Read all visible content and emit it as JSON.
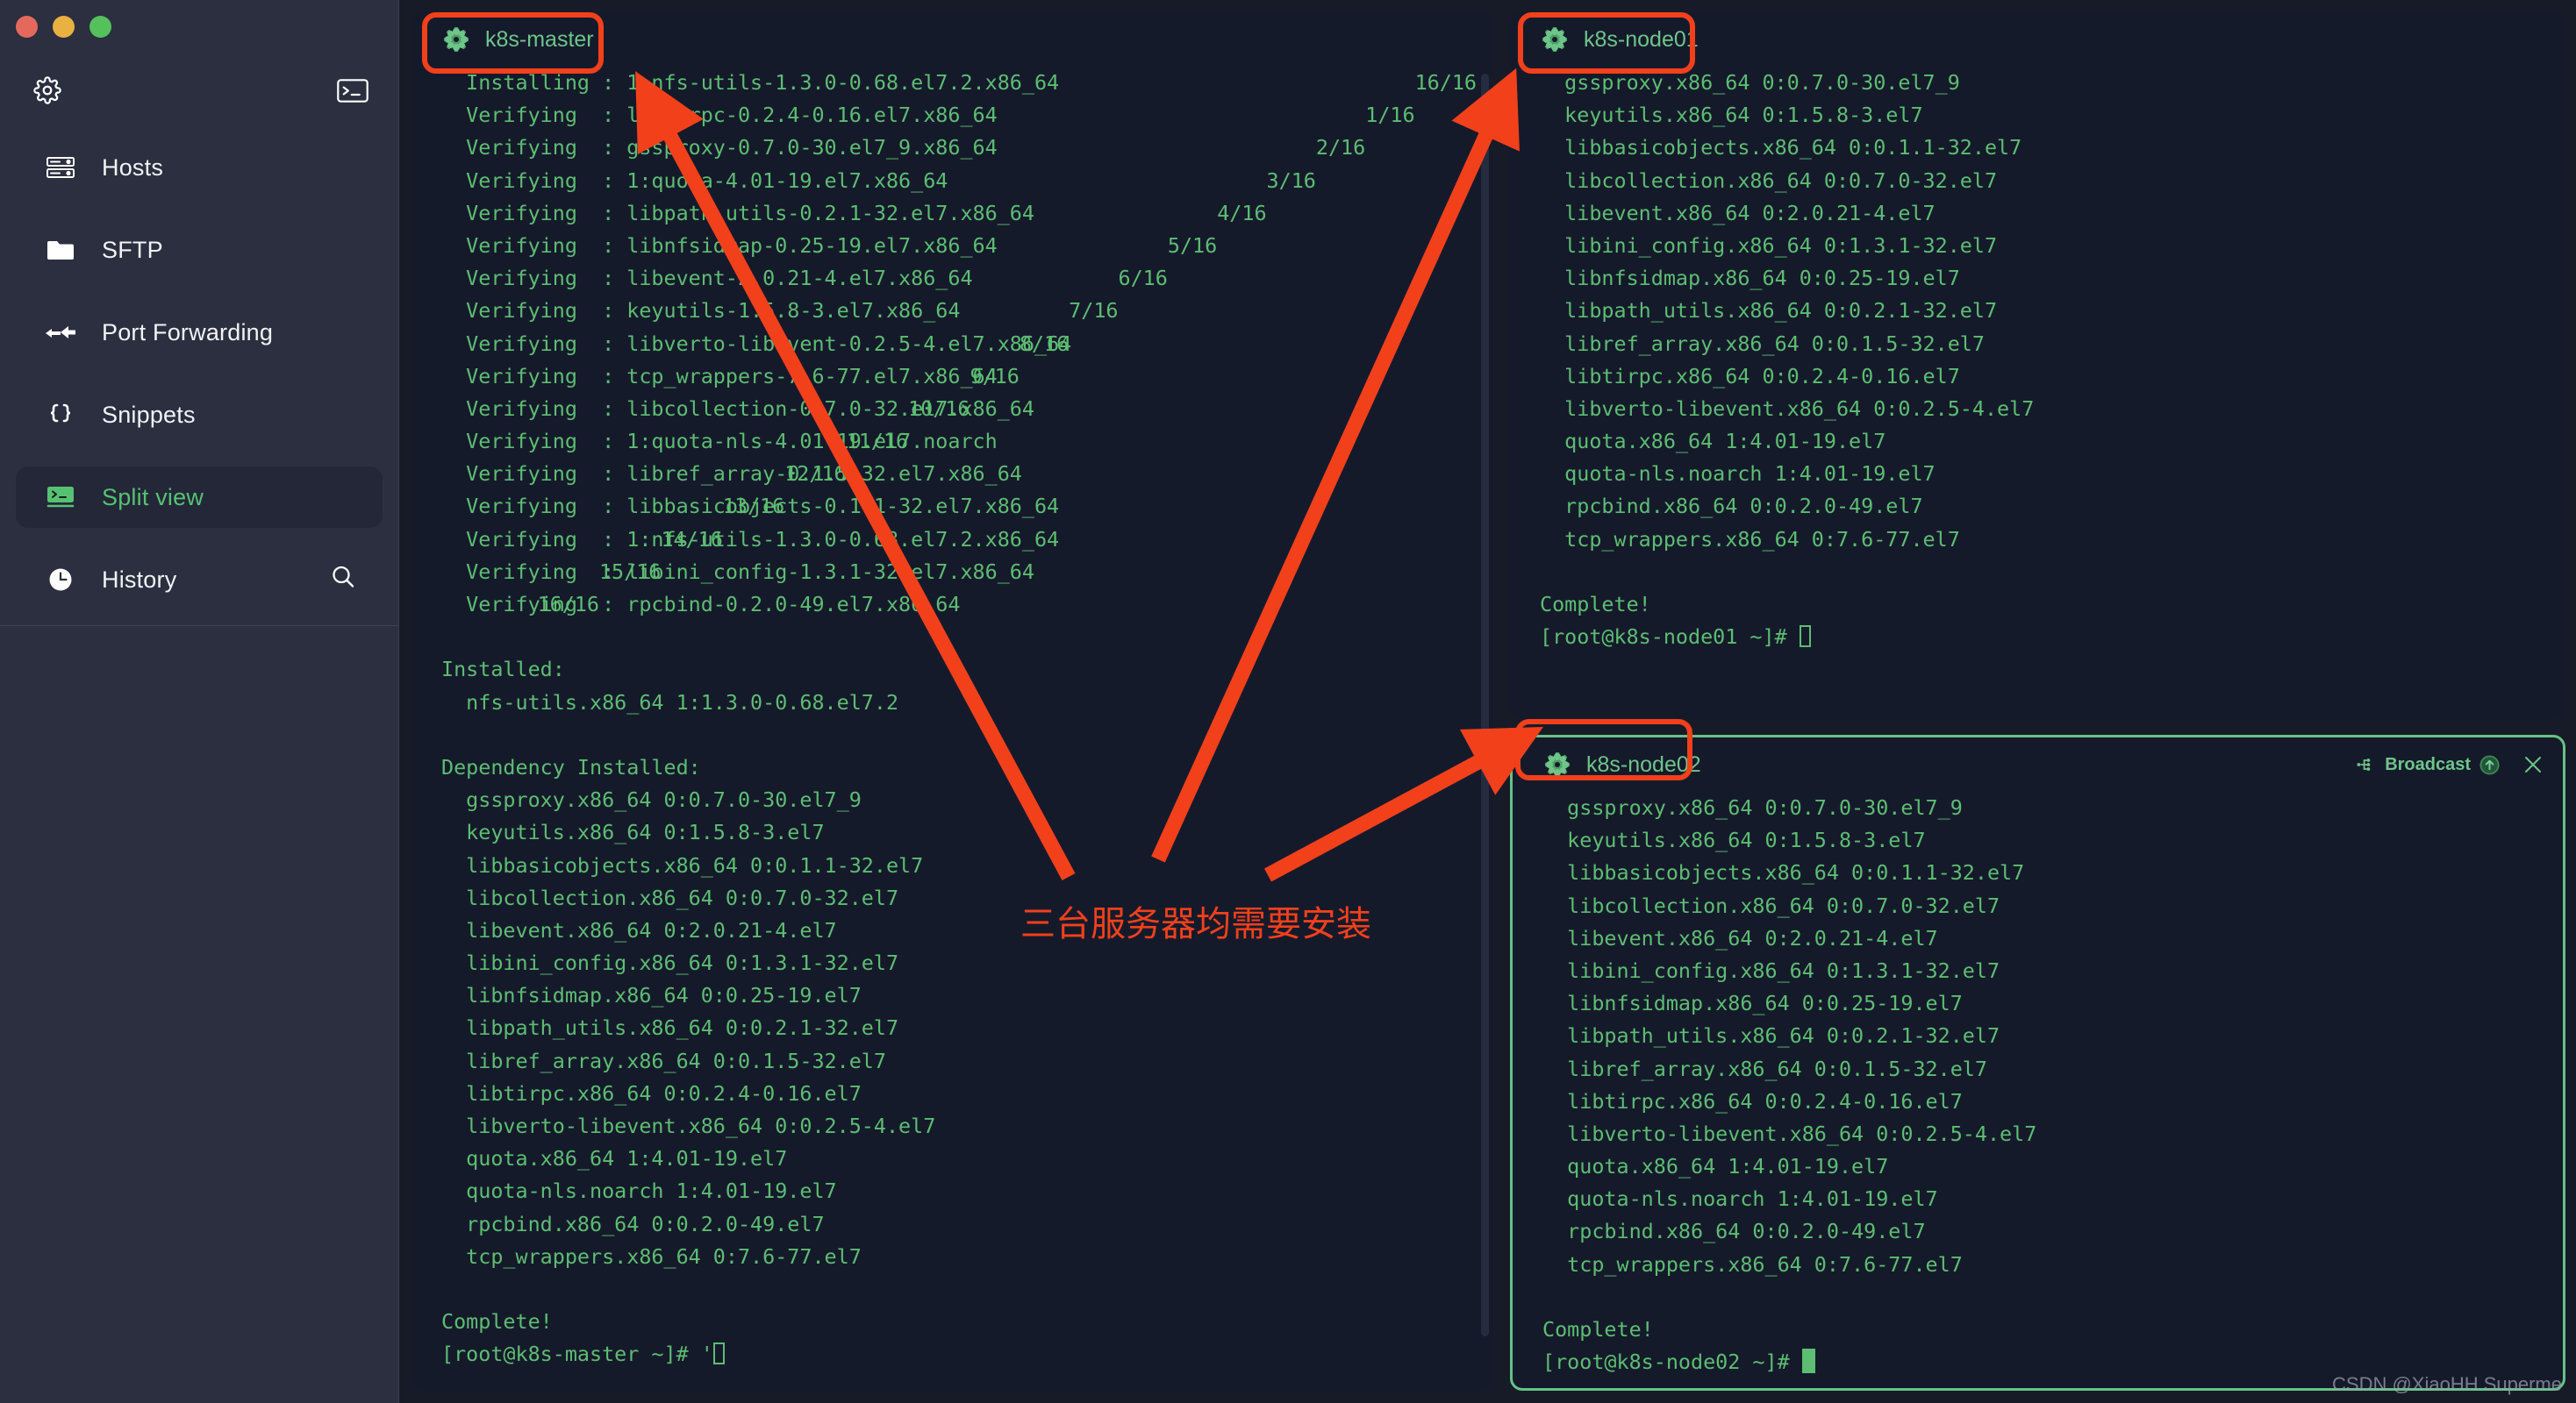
{
  "window": {
    "traffic_lights": [
      "close",
      "minimize",
      "maximize"
    ]
  },
  "sidebar": {
    "top_icons": [
      {
        "name": "gear-icon",
        "label": "Settings"
      },
      {
        "name": "terminal-icon",
        "label": "New terminal"
      }
    ],
    "items": [
      {
        "label": "Hosts",
        "icon": "server-rack-icon",
        "active": false
      },
      {
        "label": "SFTP",
        "icon": "folder-icon",
        "active": false
      },
      {
        "label": "Port Forwarding",
        "icon": "arrow-forward-icon",
        "active": false
      },
      {
        "label": "Snippets",
        "icon": "braces-icon",
        "active": false
      },
      {
        "label": "Split view",
        "icon": "split-view-icon",
        "active": true
      },
      {
        "label": "History",
        "icon": "clock-icon",
        "active": false,
        "trailing_icon": "search-icon"
      }
    ]
  },
  "colors": {
    "accent_green": "#56c271",
    "terminal_green": "#5dbd72",
    "annotation_red": "#f2401b",
    "focus_border": "#67c286",
    "sidebar_bg": "#2b2f3f",
    "terminal_bg": "#151a2b"
  },
  "panes": [
    {
      "id": "k8s-master",
      "title": "k8s-master",
      "icon": "k8s-flower-icon",
      "focused": false,
      "has_broadcast": false,
      "lines": [
        {
          "text": "  Installing : 1:nfs-utils-1.3.0-0.68.el7.2.x86_64",
          "count": "16/16"
        },
        {
          "text": "  Verifying  : libtirpc-0.2.4-0.16.el7.x86_64",
          "count": "1/16"
        },
        {
          "text": "  Verifying  : gssproxy-0.7.0-30.el7_9.x86_64",
          "count": "2/16"
        },
        {
          "text": "  Verifying  : 1:quota-4.01-19.el7.x86_64",
          "count": "3/16"
        },
        {
          "text": "  Verifying  : libpath_utils-0.2.1-32.el7.x86_64",
          "count": "4/16"
        },
        {
          "text": "  Verifying  : libnfsidmap-0.25-19.el7.x86_64",
          "count": "5/16"
        },
        {
          "text": "  Verifying  : libevent-2.0.21-4.el7.x86_64",
          "count": "6/16"
        },
        {
          "text": "  Verifying  : keyutils-1.5.8-3.el7.x86_64",
          "count": "7/16"
        },
        {
          "text": "  Verifying  : libverto-libevent-0.2.5-4.el7.x86_64",
          "count": "8/16"
        },
        {
          "text": "  Verifying  : tcp_wrappers-7.6-77.el7.x86_64",
          "count": "9/16"
        },
        {
          "text": "  Verifying  : libcollection-0.7.0-32.el7.x86_64",
          "count": "10/16"
        },
        {
          "text": "  Verifying  : 1:quota-nls-4.01-19.el7.noarch",
          "count": "11/16"
        },
        {
          "text": "  Verifying  : libref_array-0.1.5-32.el7.x86_64",
          "count": "12/16"
        },
        {
          "text": "  Verifying  : libbasicobjects-0.1.1-32.el7.x86_64",
          "count": "13/16"
        },
        {
          "text": "  Verifying  : 1:nfs-utils-1.3.0-0.68.el7.2.x86_64",
          "count": "14/16"
        },
        {
          "text": "  Verifying  : libini_config-1.3.1-32.el7.x86_64",
          "count": "15/16"
        },
        {
          "text": "  Verifying  : rpcbind-0.2.0-49.el7.x86_64",
          "count": "16/16"
        },
        {
          "text": "",
          "count": ""
        },
        {
          "text": "Installed:",
          "count": ""
        },
        {
          "text": "  nfs-utils.x86_64 1:1.3.0-0.68.el7.2",
          "count": ""
        },
        {
          "text": "",
          "count": ""
        },
        {
          "text": "Dependency Installed:",
          "count": ""
        },
        {
          "text": "  gssproxy.x86_64 0:0.7.0-30.el7_9",
          "count": ""
        },
        {
          "text": "  keyutils.x86_64 0:1.5.8-3.el7",
          "count": ""
        },
        {
          "text": "  libbasicobjects.x86_64 0:0.1.1-32.el7",
          "count": ""
        },
        {
          "text": "  libcollection.x86_64 0:0.7.0-32.el7",
          "count": ""
        },
        {
          "text": "  libevent.x86_64 0:2.0.21-4.el7",
          "count": ""
        },
        {
          "text": "  libini_config.x86_64 0:1.3.1-32.el7",
          "count": ""
        },
        {
          "text": "  libnfsidmap.x86_64 0:0.25-19.el7",
          "count": ""
        },
        {
          "text": "  libpath_utils.x86_64 0:0.2.1-32.el7",
          "count": ""
        },
        {
          "text": "  libref_array.x86_64 0:0.1.5-32.el7",
          "count": ""
        },
        {
          "text": "  libtirpc.x86_64 0:0.2.4-0.16.el7",
          "count": ""
        },
        {
          "text": "  libverto-libevent.x86_64 0:0.2.5-4.el7",
          "count": ""
        },
        {
          "text": "  quota.x86_64 1:4.01-19.el7",
          "count": ""
        },
        {
          "text": "  quota-nls.noarch 1:4.01-19.el7",
          "count": ""
        },
        {
          "text": "  rpcbind.x86_64 0:0.2.0-49.el7",
          "count": ""
        },
        {
          "text": "  tcp_wrappers.x86_64 0:7.6-77.el7",
          "count": ""
        },
        {
          "text": "",
          "count": ""
        },
        {
          "text": "Complete!",
          "count": ""
        }
      ],
      "prompt": "[root@k8s-master ~]# '",
      "cursor": "hollow"
    },
    {
      "id": "k8s-node01",
      "title": "k8s-node01",
      "icon": "k8s-flower-icon",
      "focused": false,
      "has_broadcast": false,
      "lines": [
        {
          "text": "  gssproxy.x86_64 0:0.7.0-30.el7_9",
          "count": ""
        },
        {
          "text": "  keyutils.x86_64 0:1.5.8-3.el7",
          "count": ""
        },
        {
          "text": "  libbasicobjects.x86_64 0:0.1.1-32.el7",
          "count": ""
        },
        {
          "text": "  libcollection.x86_64 0:0.7.0-32.el7",
          "count": ""
        },
        {
          "text": "  libevent.x86_64 0:2.0.21-4.el7",
          "count": ""
        },
        {
          "text": "  libini_config.x86_64 0:1.3.1-32.el7",
          "count": ""
        },
        {
          "text": "  libnfsidmap.x86_64 0:0.25-19.el7",
          "count": ""
        },
        {
          "text": "  libpath_utils.x86_64 0:0.2.1-32.el7",
          "count": ""
        },
        {
          "text": "  libref_array.x86_64 0:0.1.5-32.el7",
          "count": ""
        },
        {
          "text": "  libtirpc.x86_64 0:0.2.4-0.16.el7",
          "count": ""
        },
        {
          "text": "  libverto-libevent.x86_64 0:0.2.5-4.el7",
          "count": ""
        },
        {
          "text": "  quota.x86_64 1:4.01-19.el7",
          "count": ""
        },
        {
          "text": "  quota-nls.noarch 1:4.01-19.el7",
          "count": ""
        },
        {
          "text": "  rpcbind.x86_64 0:0.2.0-49.el7",
          "count": ""
        },
        {
          "text": "  tcp_wrappers.x86_64 0:7.6-77.el7",
          "count": ""
        },
        {
          "text": "",
          "count": ""
        },
        {
          "text": "Complete!",
          "count": ""
        }
      ],
      "prompt": "[root@k8s-node01 ~]# ",
      "cursor": "hollow"
    },
    {
      "id": "k8s-node02",
      "title": "k8s-node02",
      "icon": "k8s-flower-icon",
      "focused": true,
      "has_broadcast": true,
      "broadcast_label": "Broadcast",
      "broadcast_icon": "broadcast-icon",
      "broadcast_toggle_icon": "arrow-up-circle-icon",
      "close_icon": "close-icon",
      "lines": [
        {
          "text": "  gssproxy.x86_64 0:0.7.0-30.el7_9",
          "count": ""
        },
        {
          "text": "  keyutils.x86_64 0:1.5.8-3.el7",
          "count": ""
        },
        {
          "text": "  libbasicobjects.x86_64 0:0.1.1-32.el7",
          "count": ""
        },
        {
          "text": "  libcollection.x86_64 0:0.7.0-32.el7",
          "count": ""
        },
        {
          "text": "  libevent.x86_64 0:2.0.21-4.el7",
          "count": ""
        },
        {
          "text": "  libini_config.x86_64 0:1.3.1-32.el7",
          "count": ""
        },
        {
          "text": "  libnfsidmap.x86_64 0:0.25-19.el7",
          "count": ""
        },
        {
          "text": "  libpath_utils.x86_64 0:0.2.1-32.el7",
          "count": ""
        },
        {
          "text": "  libref_array.x86_64 0:0.1.5-32.el7",
          "count": ""
        },
        {
          "text": "  libtirpc.x86_64 0:0.2.4-0.16.el7",
          "count": ""
        },
        {
          "text": "  libverto-libevent.x86_64 0:0.2.5-4.el7",
          "count": ""
        },
        {
          "text": "  quota.x86_64 1:4.01-19.el7",
          "count": ""
        },
        {
          "text": "  quota-nls.noarch 1:4.01-19.el7",
          "count": ""
        },
        {
          "text": "  rpcbind.x86_64 0:0.2.0-49.el7",
          "count": ""
        },
        {
          "text": "  tcp_wrappers.x86_64 0:7.6-77.el7",
          "count": ""
        },
        {
          "text": "",
          "count": ""
        },
        {
          "text": "Complete!",
          "count": ""
        }
      ],
      "prompt": "[root@k8s-node02 ~]# ",
      "cursor": "solid"
    }
  ],
  "annotations": {
    "note_text": "三台服务器均需要安装",
    "highlight_boxes": [
      "k8s-master-tab",
      "k8s-node01-tab",
      "k8s-node02-tab"
    ],
    "arrow_count": 3
  },
  "watermark": "CSDN @XiaoHH Superme"
}
